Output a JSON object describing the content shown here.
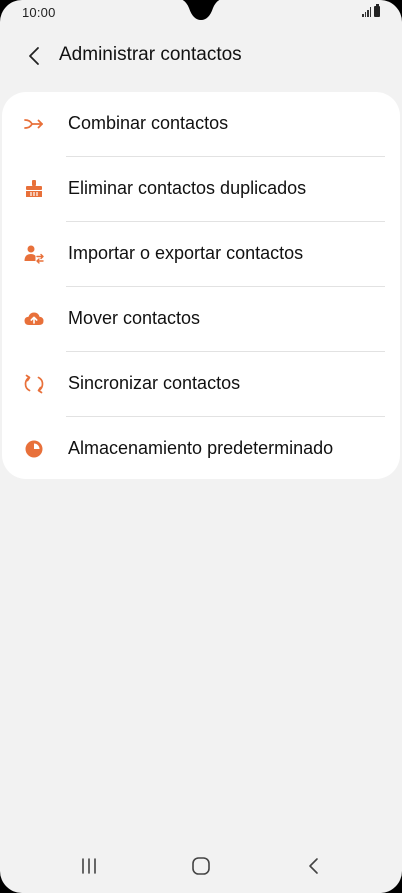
{
  "status_bar": {
    "time": "10:00",
    "icons": [
      "signal-icon",
      "battery-icon"
    ]
  },
  "header": {
    "back_icon": "chevron-left-icon",
    "title": "Administrar contactos"
  },
  "menu": {
    "items": [
      {
        "label": "Combinar contactos",
        "icon": "merge-arrow-icon"
      },
      {
        "label": "Eliminar contactos duplicados",
        "icon": "broom-icon"
      },
      {
        "label": "Importar o exportar contactos",
        "icon": "person-transfer-icon"
      },
      {
        "label": "Mover contactos",
        "icon": "cloud-upload-icon"
      },
      {
        "label": "Sincronizar contactos",
        "icon": "sync-icon"
      },
      {
        "label": "Almacenamiento predeterminado",
        "icon": "storage-pie-icon"
      }
    ]
  },
  "nav_bar": {
    "buttons": [
      "recents-icon",
      "home-icon",
      "back-icon"
    ]
  },
  "colors": {
    "accent": "#e8703a",
    "background": "#f2f2f2",
    "card": "#ffffff",
    "text": "#111111",
    "divider": "#e2e2e2"
  }
}
